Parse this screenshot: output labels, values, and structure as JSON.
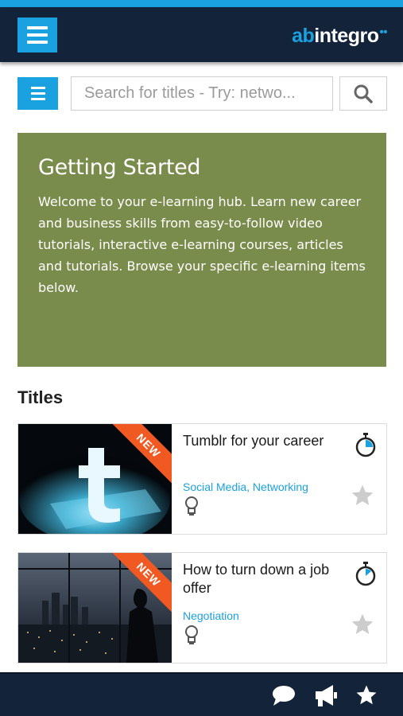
{
  "header": {
    "logo_prefix": "ab",
    "logo_main": "integro",
    "logo_suffix": "••"
  },
  "search": {
    "placeholder": "Search for titles - Try: netwo..."
  },
  "hero": {
    "title": "Getting Started",
    "body": "Welcome to your e-learning hub. Learn new career and business skills from easy-to-follow video tutorials, interactive e-learning courses, articles and tutorials. Browse your specific e-learning items below."
  },
  "section": {
    "title": "Titles"
  },
  "cards": [
    {
      "badge": "NEW",
      "title": "Tumblr for your career",
      "tags": "Social Media, Networking",
      "thumb_icon": "tumblr-logo-icon"
    },
    {
      "badge": "NEW",
      "title": "How to turn down a job offer",
      "tags": "Negotiation",
      "thumb_icon": "city-night-icon"
    }
  ],
  "footer": {
    "icons": [
      "chat-icon",
      "megaphone-icon",
      "star-icon"
    ]
  },
  "colors": {
    "accent": "#1aa1e0",
    "header_bg": "#13233a",
    "hero_bg": "#7a8c4b",
    "badge": "#f05a22",
    "star_inactive": "#cccccc"
  }
}
